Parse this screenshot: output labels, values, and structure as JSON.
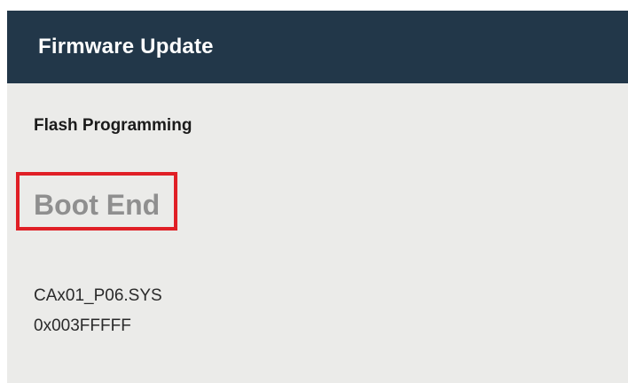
{
  "header": {
    "title": "Firmware Update"
  },
  "content": {
    "section_title": "Flash Programming",
    "status": "Boot End",
    "file_name": "CAx01_P06.SYS",
    "address": "0x003FFFFF"
  },
  "colors": {
    "header_background": "#223749",
    "screen_background": "#ebebe9",
    "highlight_border": "#e01f26",
    "status_text": "#8f8f8f"
  }
}
